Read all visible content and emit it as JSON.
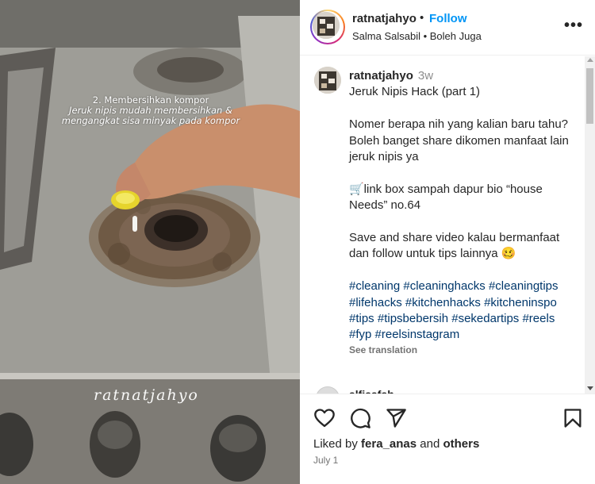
{
  "media": {
    "overlay_line1": "2. Membersihkan kompor",
    "overlay_line2": "Jeruk nipis mudah membersihkan &",
    "overlay_line3": "mengangkat sisa minyak pada kompor",
    "watermark": "ratnatjahyo"
  },
  "header": {
    "username": "ratnatjahyo",
    "dot": "•",
    "follow": "Follow",
    "subtitle": "Salma Salsabil • Boleh Juga",
    "more_icon": "more-horizontal-icon"
  },
  "caption": {
    "username": "ratnatjahyo",
    "time": "3w",
    "lines": {
      "title": "Jeruk Nipis Hack (part 1)",
      "q1": "Nomer berapa nih yang kalian baru tahu?",
      "q2": "Boleh banget share dikomen manfaat lain jeruk nipis ya",
      "link": "🛒link box sampah dapur bio “house Needs” no.64",
      "save": "Save and share video kalau bermanfaat dan follow untuk tips lainnya 🥴"
    },
    "hashtags": "#cleaning #cleaninghacks #cleaningtips #lifehacks #kitchenhacks #kitcheninspo #tips #tipsbebersih #sekedartips #reels #fyp #reelsinstagram",
    "see_translation": "See translation"
  },
  "next_comment": {
    "username": "alfiaafah"
  },
  "actions": {
    "like_icon": "heart-icon",
    "comment_icon": "comment-icon",
    "share_icon": "send-icon",
    "save_icon": "bookmark-icon",
    "liked_prefix": "Liked by ",
    "liked_user": "fera_anas",
    "liked_middle": " and ",
    "liked_others": "others",
    "date": "July 1"
  },
  "colors": {
    "follow": "#0095f6",
    "hashtag": "#00376b",
    "text": "#262626",
    "muted": "#737373"
  }
}
